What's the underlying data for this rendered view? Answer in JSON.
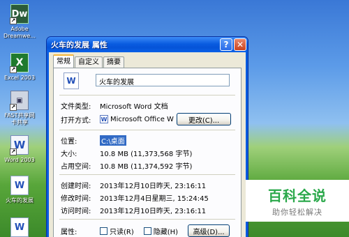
{
  "desktop": {
    "icons": [
      {
        "name": "dreamweaver",
        "glyph": "Dw",
        "label": "Adobe\nDreamwe..."
      },
      {
        "name": "excel",
        "glyph": "X",
        "label": "Excel 2003"
      },
      {
        "name": "fastcopy",
        "glyph": "▣",
        "label": "FAST共享网\n卡共享"
      },
      {
        "name": "word",
        "glyph": "W",
        "label": "Word 2003"
      },
      {
        "name": "doc-file",
        "glyph": "W",
        "label": "火车的发展"
      },
      {
        "name": "doc-file-2",
        "glyph": "W",
        "label": ""
      }
    ]
  },
  "window": {
    "title": "火车的发展 属性",
    "help_glyph": "?",
    "close_glyph": "✕",
    "tabs": [
      "常规",
      "自定义",
      "摘要"
    ],
    "active_tab": "常规"
  },
  "general": {
    "file_name": "火车的发展",
    "type_label": "文件类型:",
    "type_value": "Microsoft Word 文档",
    "open_with_label": "打开方式:",
    "open_with_value": "Microsoft Office Wo",
    "change_button": "更改(C)...",
    "location_label": "位置:",
    "location_value": "C:\\桌面",
    "size_label": "大小:",
    "size_value": "10.8 MB (11,373,568 字节)",
    "size_on_disk_label": "占用空间:",
    "size_on_disk_value": "10.8 MB (11,374,592 字节)",
    "created_label": "创建时间:",
    "created_value": "2013年12月10日昨天, 23:16:11",
    "modified_label": "修改时间:",
    "modified_value": "2013年12月4日星期三, 15:24:45",
    "accessed_label": "访问时间:",
    "accessed_value": "2013年12月10日昨天, 23:16:11",
    "attributes_label": "属性:",
    "readonly_label": "只读(R)",
    "hidden_label": "隐藏(H)",
    "advanced_button": "高级(D)..."
  },
  "watermark": {
    "title": "百科全说",
    "subtitle": "助你轻松解决"
  }
}
